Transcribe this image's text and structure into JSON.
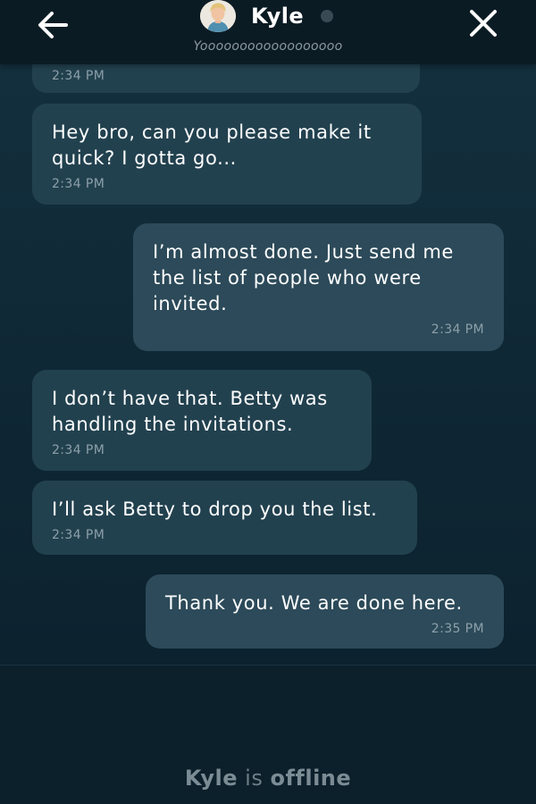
{
  "header": {
    "contact_name": "Kyle",
    "status_message": "Yoooooooooooooooooo",
    "presence": "offline",
    "presence_dot_color": "#3a4a54",
    "back_icon": "arrow-left-icon",
    "close_icon": "close-icon"
  },
  "messages": [
    {
      "direction": "incoming",
      "text": "",
      "time": "2:34 PM"
    },
    {
      "direction": "incoming",
      "text": "Hey bro, can you please make it quick? I gotta go...",
      "time": "2:34 PM"
    },
    {
      "direction": "outgoing",
      "text": "I’m almost done. Just send me the list of people who were invited.",
      "time": "2:34 PM"
    },
    {
      "direction": "incoming",
      "text": "I don’t have that. Betty was handling the invitations.",
      "time": "2:34 PM"
    },
    {
      "direction": "incoming",
      "text": "I’ll ask Betty to drop you the list.",
      "time": "2:34 PM"
    },
    {
      "direction": "outgoing",
      "text": "Thank you. We are done here.",
      "time": "2:35 PM"
    }
  ],
  "footer": {
    "offline_name": "Kyle",
    "offline_is": "is",
    "offline_state": "offline"
  },
  "colors": {
    "background": "#0f2836",
    "header_bg": "#0b1b24",
    "incoming_bubble": "#22414f",
    "outgoing_bubble": "#2c4a59",
    "timestamp": "#8da0aa"
  }
}
